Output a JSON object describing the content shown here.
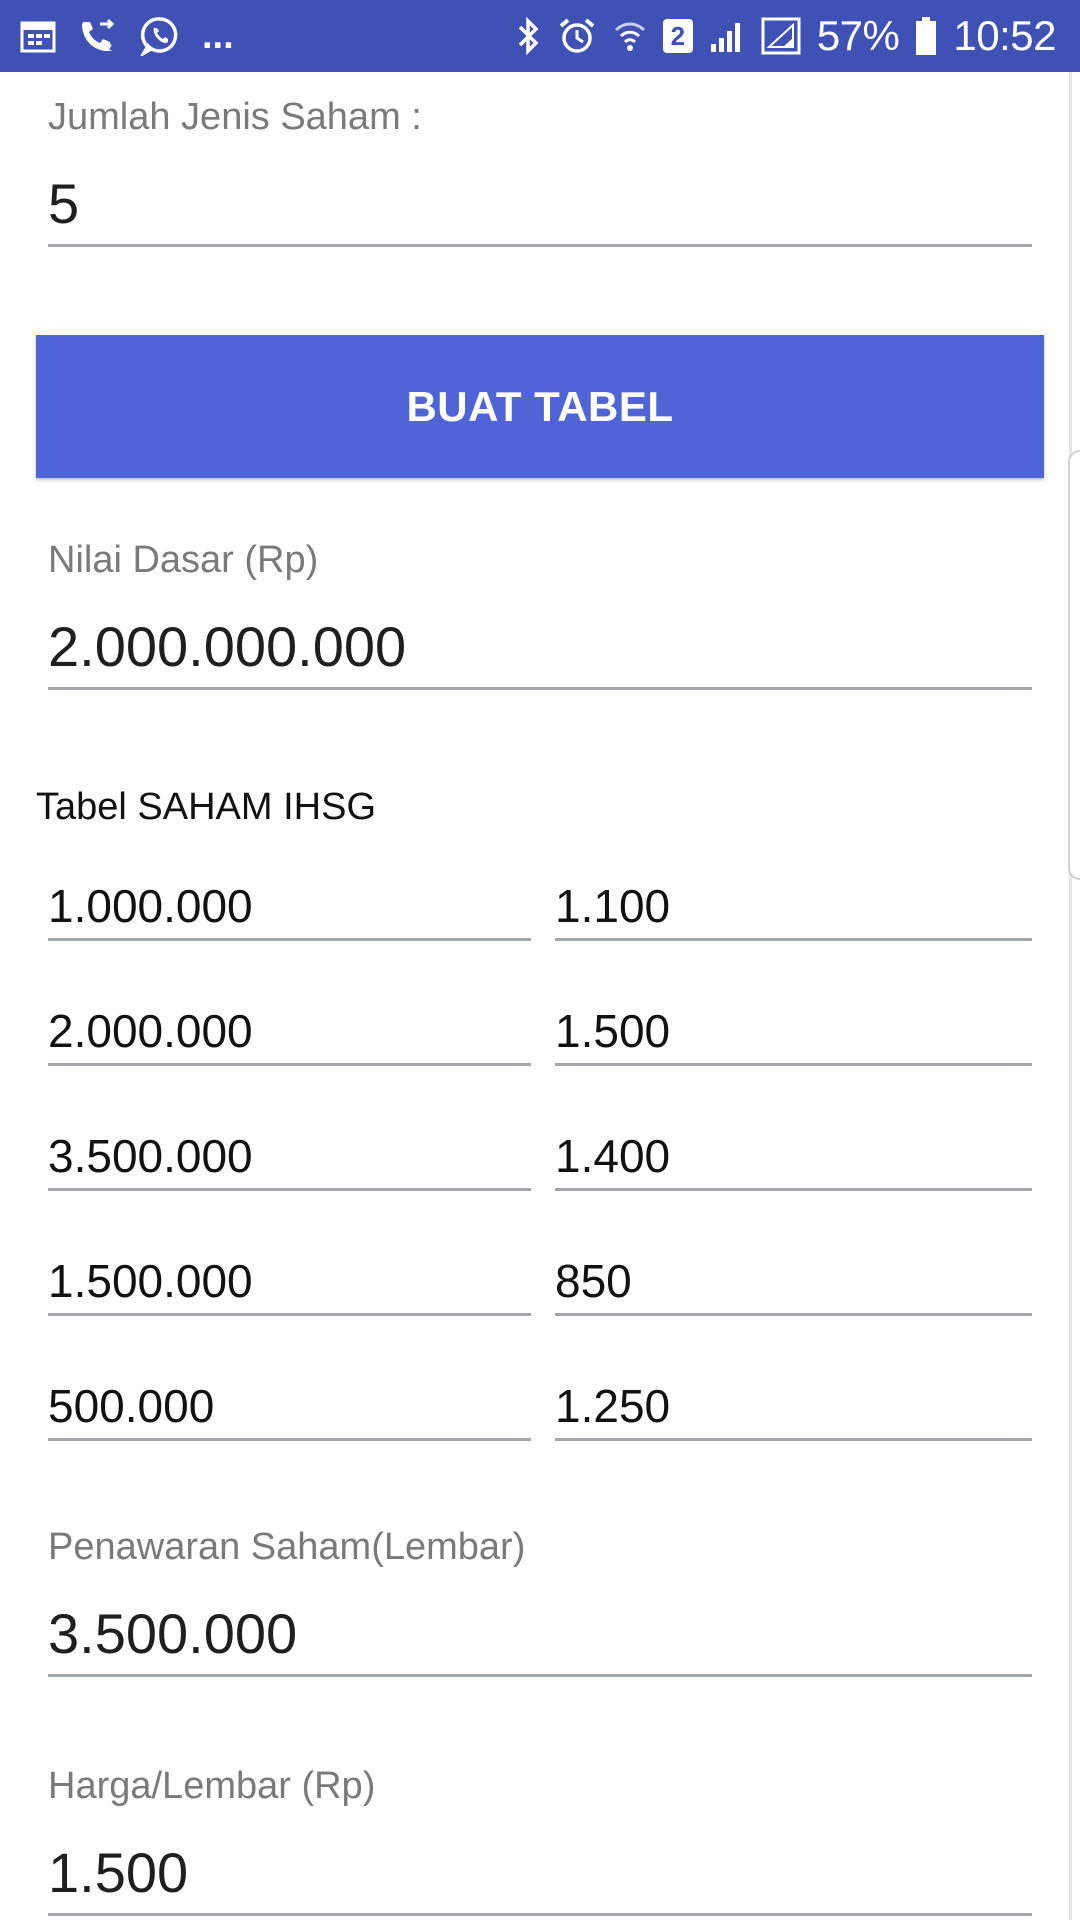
{
  "status_bar": {
    "icons_left": [
      "calendar-icon",
      "call-forward-icon",
      "whatsapp-icon"
    ],
    "overflow": "...",
    "icons_right": [
      "bluetooth-icon",
      "alarm-icon",
      "wifi-icon",
      "sim-2-badge",
      "signal-icon",
      "signal-icon",
      "battery-icon"
    ],
    "sim_number": "2",
    "battery_percent": "57%",
    "time": "10:52",
    "color": "#3f51b5"
  },
  "form": {
    "jumlah_label": "Jumlah Jenis Saham :",
    "jumlah_value": "5",
    "buat_button": "BUAT TABEL",
    "nilai_label": "Nilai Dasar (Rp)",
    "nilai_value": "2.000.000.000",
    "table_title": "Tabel SAHAM IHSG",
    "table_rows": [
      {
        "a": "1.000.000",
        "b": "1.100"
      },
      {
        "a": "2.000.000",
        "b": "1.500"
      },
      {
        "a": "3.500.000",
        "b": "1.400"
      },
      {
        "a": "1.500.000",
        "b": "850"
      },
      {
        "a": "500.000",
        "b": "1.250"
      }
    ],
    "penawaran_label": "Penawaran Saham(Lembar)",
    "penawaran_value": "3.500.000",
    "harga_label": "Harga/Lembar (Rp)",
    "harga_value": "1.500"
  },
  "colors": {
    "accent_button": "#4f64d7",
    "underline": "#a3a7ab"
  }
}
